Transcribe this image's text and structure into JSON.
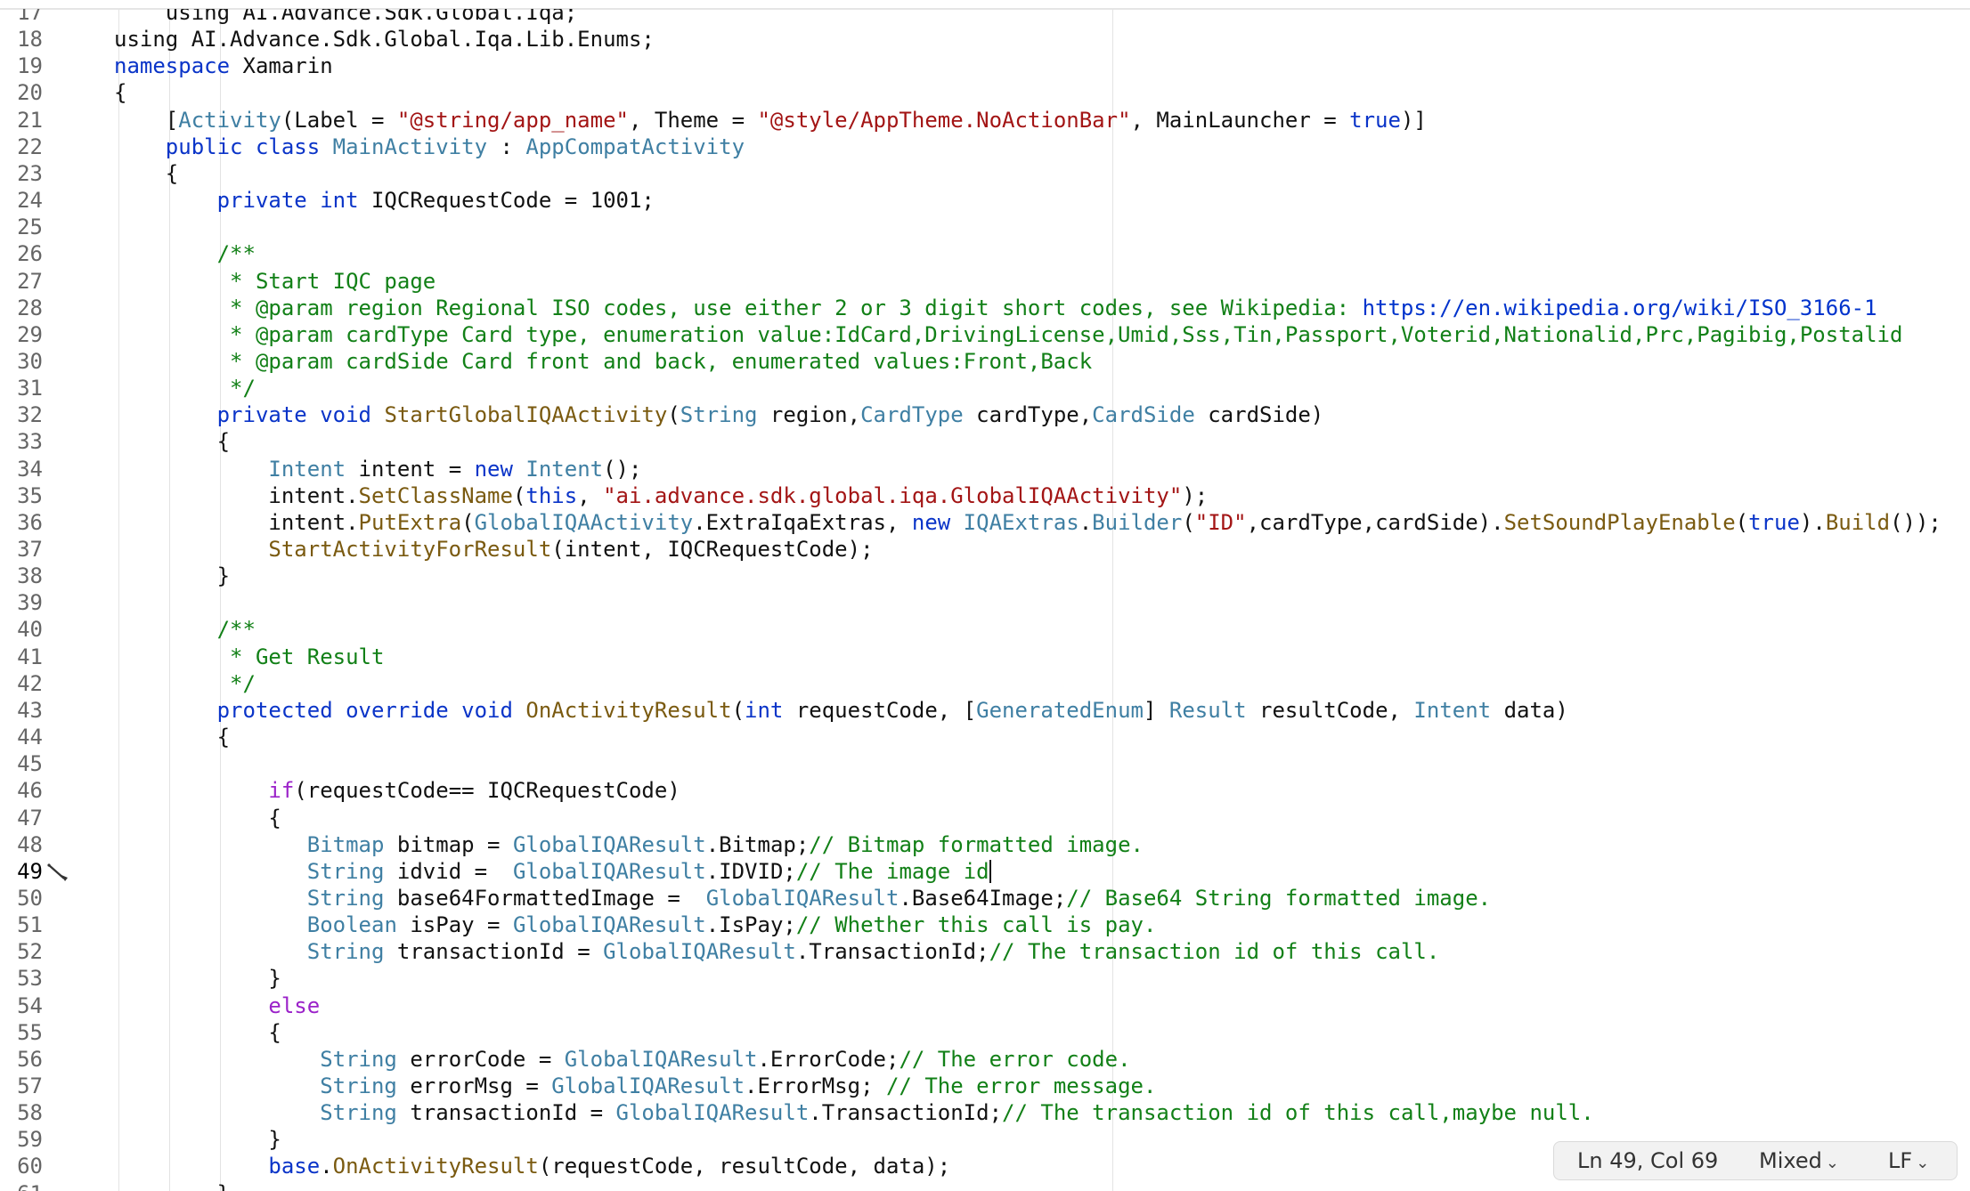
{
  "editor": {
    "lines": [
      {
        "n": "17",
        "tokens": [
          {
            "t": "    using AI.Advance.Sdk.Global.Iqa;",
            "c": ""
          }
        ]
      },
      {
        "n": "18",
        "tokens": [
          {
            "t": "using AI.Advance.Sdk.Global.Iqa.Lib.Enums;",
            "c": ""
          }
        ]
      },
      {
        "n": "19",
        "tokens": [
          {
            "t": "namespace",
            "c": "kw"
          },
          {
            "t": " Xamarin",
            "c": ""
          }
        ]
      },
      {
        "n": "20",
        "tokens": [
          {
            "t": "{",
            "c": ""
          }
        ]
      },
      {
        "n": "21",
        "tokens": [
          {
            "t": "    [",
            "c": ""
          },
          {
            "t": "Activity",
            "c": "ty"
          },
          {
            "t": "(Label = ",
            "c": ""
          },
          {
            "t": "\"@string/app_name\"",
            "c": "st"
          },
          {
            "t": ", Theme = ",
            "c": ""
          },
          {
            "t": "\"@style/AppTheme.NoActionBar\"",
            "c": "st"
          },
          {
            "t": ", MainLauncher = ",
            "c": ""
          },
          {
            "t": "true",
            "c": "kw"
          },
          {
            "t": ")]",
            "c": ""
          }
        ]
      },
      {
        "n": "22",
        "tokens": [
          {
            "t": "    public class ",
            "c": "kw"
          },
          {
            "t": "MainActivity",
            "c": "ty"
          },
          {
            "t": " : ",
            "c": ""
          },
          {
            "t": "AppCompatActivity",
            "c": "ty"
          }
        ]
      },
      {
        "n": "23",
        "tokens": [
          {
            "t": "    {",
            "c": ""
          }
        ]
      },
      {
        "n": "24",
        "tokens": [
          {
            "t": "        private int ",
            "c": "kw"
          },
          {
            "t": "IQCRequestCode = 1001;",
            "c": ""
          }
        ]
      },
      {
        "n": "25",
        "tokens": []
      },
      {
        "n": "26",
        "tokens": [
          {
            "t": "        /**",
            "c": "cm"
          }
        ]
      },
      {
        "n": "27",
        "tokens": [
          {
            "t": "         * Start IQC page",
            "c": "cm"
          }
        ]
      },
      {
        "n": "28",
        "tokens": [
          {
            "t": "         * @param region Regional ISO codes, use either 2 or 3 digit short codes, see Wikipedia: ",
            "c": "cm"
          },
          {
            "t": "https://en.wikipedia.org/wiki/ISO_3166-1",
            "c": "lk"
          }
        ]
      },
      {
        "n": "29",
        "tokens": [
          {
            "t": "         * @param cardType Card type, enumeration value:IdCard,DrivingLicense,Umid,Sss,Tin,Passport,Voterid,Nationalid,Prc,Pagibig,Postalid",
            "c": "cm"
          }
        ]
      },
      {
        "n": "30",
        "tokens": [
          {
            "t": "         * @param cardSide Card front and back, enumerated values:Front,Back",
            "c": "cm"
          }
        ]
      },
      {
        "n": "31",
        "tokens": [
          {
            "t": "         */",
            "c": "cm"
          }
        ]
      },
      {
        "n": "32",
        "tokens": [
          {
            "t": "        private void ",
            "c": "kw"
          },
          {
            "t": "StartGlobalIQAActivity",
            "c": "fn"
          },
          {
            "t": "(",
            "c": ""
          },
          {
            "t": "String",
            "c": "ty"
          },
          {
            "t": " region,",
            "c": ""
          },
          {
            "t": "CardType",
            "c": "ty"
          },
          {
            "t": " cardType,",
            "c": ""
          },
          {
            "t": "CardSide",
            "c": "ty"
          },
          {
            "t": " cardSide)",
            "c": ""
          }
        ]
      },
      {
        "n": "33",
        "tokens": [
          {
            "t": "        {",
            "c": ""
          }
        ]
      },
      {
        "n": "34",
        "tokens": [
          {
            "t": "            ",
            "c": ""
          },
          {
            "t": "Intent",
            "c": "ty"
          },
          {
            "t": " intent = ",
            "c": ""
          },
          {
            "t": "new ",
            "c": "kw"
          },
          {
            "t": "Intent",
            "c": "ty"
          },
          {
            "t": "();",
            "c": ""
          }
        ]
      },
      {
        "n": "35",
        "tokens": [
          {
            "t": "            intent.",
            "c": ""
          },
          {
            "t": "SetClassName",
            "c": "fn"
          },
          {
            "t": "(",
            "c": ""
          },
          {
            "t": "this",
            "c": "kw"
          },
          {
            "t": ", ",
            "c": ""
          },
          {
            "t": "\"ai.advance.sdk.global.iqa.GlobalIQAActivity\"",
            "c": "st"
          },
          {
            "t": ");",
            "c": ""
          }
        ]
      },
      {
        "n": "36",
        "tokens": [
          {
            "t": "            intent.",
            "c": ""
          },
          {
            "t": "PutExtra",
            "c": "fn"
          },
          {
            "t": "(",
            "c": ""
          },
          {
            "t": "GlobalIQAActivity",
            "c": "ty"
          },
          {
            "t": ".ExtraIqaExtras, ",
            "c": ""
          },
          {
            "t": "new ",
            "c": "kw"
          },
          {
            "t": "IQAExtras",
            "c": "ty"
          },
          {
            "t": ".",
            "c": ""
          },
          {
            "t": "Builder",
            "c": "ty"
          },
          {
            "t": "(",
            "c": ""
          },
          {
            "t": "\"ID\"",
            "c": "st"
          },
          {
            "t": ",cardType,cardSide).",
            "c": ""
          },
          {
            "t": "SetSoundPlayEnable",
            "c": "fn"
          },
          {
            "t": "(",
            "c": ""
          },
          {
            "t": "true",
            "c": "kw"
          },
          {
            "t": ").",
            "c": ""
          },
          {
            "t": "Build",
            "c": "fn"
          },
          {
            "t": "());",
            "c": ""
          }
        ]
      },
      {
        "n": "37",
        "tokens": [
          {
            "t": "            ",
            "c": ""
          },
          {
            "t": "StartActivityForResult",
            "c": "fn"
          },
          {
            "t": "(intent, IQCRequestCode);",
            "c": ""
          }
        ]
      },
      {
        "n": "38",
        "tokens": [
          {
            "t": "        }",
            "c": ""
          }
        ]
      },
      {
        "n": "39",
        "tokens": []
      },
      {
        "n": "40",
        "tokens": [
          {
            "t": "        /**",
            "c": "cm"
          }
        ]
      },
      {
        "n": "41",
        "tokens": [
          {
            "t": "         * Get Result",
            "c": "cm"
          }
        ]
      },
      {
        "n": "42",
        "tokens": [
          {
            "t": "         */",
            "c": "cm"
          }
        ]
      },
      {
        "n": "43",
        "tokens": [
          {
            "t": "        protected override void ",
            "c": "kw"
          },
          {
            "t": "OnActivityResult",
            "c": "fn"
          },
          {
            "t": "(",
            "c": ""
          },
          {
            "t": "int",
            "c": "kw"
          },
          {
            "t": " requestCode, [",
            "c": ""
          },
          {
            "t": "GeneratedEnum",
            "c": "ty"
          },
          {
            "t": "] ",
            "c": ""
          },
          {
            "t": "Result",
            "c": "ty"
          },
          {
            "t": " resultCode, ",
            "c": ""
          },
          {
            "t": "Intent",
            "c": "ty"
          },
          {
            "t": " data)",
            "c": ""
          }
        ]
      },
      {
        "n": "44",
        "tokens": [
          {
            "t": "        {",
            "c": ""
          }
        ]
      },
      {
        "n": "45",
        "tokens": []
      },
      {
        "n": "46",
        "tokens": [
          {
            "t": "            ",
            "c": ""
          },
          {
            "t": "if",
            "c": "ctl"
          },
          {
            "t": "(requestCode== IQCRequestCode)",
            "c": ""
          }
        ]
      },
      {
        "n": "47",
        "tokens": [
          {
            "t": "            {",
            "c": ""
          }
        ]
      },
      {
        "n": "48",
        "tokens": [
          {
            "t": "               ",
            "c": ""
          },
          {
            "t": "Bitmap",
            "c": "ty"
          },
          {
            "t": " bitmap = ",
            "c": ""
          },
          {
            "t": "GlobalIQAResult",
            "c": "ty"
          },
          {
            "t": ".Bitmap;",
            "c": ""
          },
          {
            "t": "// Bitmap formatted image.",
            "c": "cm"
          }
        ]
      },
      {
        "n": "49",
        "tokens": [
          {
            "t": "               ",
            "c": ""
          },
          {
            "t": "String",
            "c": "ty"
          },
          {
            "t": " idvid =  ",
            "c": ""
          },
          {
            "t": "GlobalIQAResult",
            "c": "ty"
          },
          {
            "t": ".IDVID;",
            "c": ""
          },
          {
            "t": "// The image id",
            "c": "cm"
          }
        ]
      },
      {
        "n": "50",
        "tokens": [
          {
            "t": "               ",
            "c": ""
          },
          {
            "t": "String",
            "c": "ty"
          },
          {
            "t": " base64FormattedImage =  ",
            "c": ""
          },
          {
            "t": "GlobalIQAResult",
            "c": "ty"
          },
          {
            "t": ".Base64Image;",
            "c": ""
          },
          {
            "t": "// Base64 String formatted image.",
            "c": "cm"
          }
        ]
      },
      {
        "n": "51",
        "tokens": [
          {
            "t": "               ",
            "c": ""
          },
          {
            "t": "Boolean",
            "c": "ty"
          },
          {
            "t": " isPay = ",
            "c": ""
          },
          {
            "t": "GlobalIQAResult",
            "c": "ty"
          },
          {
            "t": ".IsPay;",
            "c": ""
          },
          {
            "t": "// Whether this call is pay.",
            "c": "cm"
          }
        ]
      },
      {
        "n": "52",
        "tokens": [
          {
            "t": "               ",
            "c": ""
          },
          {
            "t": "String",
            "c": "ty"
          },
          {
            "t": " transactionId = ",
            "c": ""
          },
          {
            "t": "GlobalIQAResult",
            "c": "ty"
          },
          {
            "t": ".TransactionId;",
            "c": ""
          },
          {
            "t": "// The transaction id of this call.",
            "c": "cm"
          }
        ]
      },
      {
        "n": "53",
        "tokens": [
          {
            "t": "            }",
            "c": ""
          }
        ]
      },
      {
        "n": "54",
        "tokens": [
          {
            "t": "            ",
            "c": ""
          },
          {
            "t": "else",
            "c": "ctl"
          }
        ]
      },
      {
        "n": "55",
        "tokens": [
          {
            "t": "            {",
            "c": ""
          }
        ]
      },
      {
        "n": "56",
        "tokens": [
          {
            "t": "                ",
            "c": ""
          },
          {
            "t": "String",
            "c": "ty"
          },
          {
            "t": " errorCode = ",
            "c": ""
          },
          {
            "t": "GlobalIQAResult",
            "c": "ty"
          },
          {
            "t": ".ErrorCode;",
            "c": ""
          },
          {
            "t": "// The error code.",
            "c": "cm"
          }
        ]
      },
      {
        "n": "57",
        "tokens": [
          {
            "t": "                ",
            "c": ""
          },
          {
            "t": "String",
            "c": "ty"
          },
          {
            "t": " errorMsg = ",
            "c": ""
          },
          {
            "t": "GlobalIQAResult",
            "c": "ty"
          },
          {
            "t": ".ErrorMsg; ",
            "c": ""
          },
          {
            "t": "// The error message.",
            "c": "cm"
          }
        ]
      },
      {
        "n": "58",
        "tokens": [
          {
            "t": "                ",
            "c": ""
          },
          {
            "t": "String",
            "c": "ty"
          },
          {
            "t": " transactionId = ",
            "c": ""
          },
          {
            "t": "GlobalIQAResult",
            "c": "ty"
          },
          {
            "t": ".TransactionId;",
            "c": ""
          },
          {
            "t": "// The transaction id of this call,maybe null.",
            "c": "cm"
          }
        ]
      },
      {
        "n": "59",
        "tokens": [
          {
            "t": "            }",
            "c": ""
          }
        ]
      },
      {
        "n": "60",
        "tokens": [
          {
            "t": "            ",
            "c": ""
          },
          {
            "t": "base",
            "c": "kw"
          },
          {
            "t": ".",
            "c": ""
          },
          {
            "t": "OnActivityResult",
            "c": "fn"
          },
          {
            "t": "(requestCode, resultCode, data);",
            "c": ""
          }
        ]
      },
      {
        "n": "61",
        "tokens": [
          {
            "t": "        }",
            "c": ""
          }
        ]
      }
    ],
    "current_line": "49",
    "cursor_icon": "edit-pencil-icon"
  },
  "statusbar": {
    "position": "Ln 49, Col 69",
    "indentation": "Mixed",
    "line_ending": "LF"
  },
  "colors": {
    "keyword": "#0a34c8",
    "type": "#3f7fa3",
    "method": "#7a5a10",
    "string": "#a31515",
    "comment": "#128017",
    "control": "#9b22c9"
  }
}
